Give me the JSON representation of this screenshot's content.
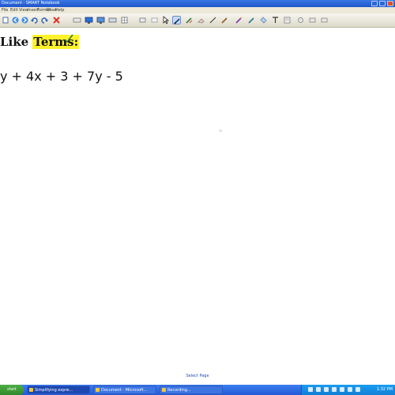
{
  "window": {
    "title": "Document - SMART Notebook"
  },
  "menu": {
    "items": [
      "File",
      "Edit",
      "View",
      "Insert",
      "Format",
      "Draw",
      "Help"
    ]
  },
  "toolbar": {
    "buttons": [
      {
        "name": "new-page-icon"
      },
      {
        "name": "previous-page-icon"
      },
      {
        "name": "next-page-icon"
      },
      {
        "name": "undo-icon"
      },
      {
        "name": "redo-icon"
      },
      {
        "name": "delete-icon"
      },
      {
        "name": "screen-shade-icon"
      },
      {
        "name": "full-screen-icon"
      },
      {
        "name": "dual-page-icon"
      },
      {
        "name": "insert-table-icon"
      },
      {
        "name": "select-icon"
      },
      {
        "name": "pen-icon"
      },
      {
        "name": "creative-pen-icon"
      },
      {
        "name": "eraser-icon"
      },
      {
        "name": "line-icon"
      },
      {
        "name": "shapes-icon"
      },
      {
        "name": "magic-pen-icon"
      },
      {
        "name": "shape-recognition-icon"
      },
      {
        "name": "fill-icon"
      },
      {
        "name": "text-icon"
      },
      {
        "name": "properties-icon"
      }
    ]
  },
  "content": {
    "heading_prefix": "Like ",
    "heading_highlight": "Terms:",
    "expression": "y + 4x + 3 + 7y - 5",
    "page_link": "Select Page"
  },
  "taskbar": {
    "start_label": "start",
    "tasks": [
      {
        "label": "Simplifying expre...",
        "active": true
      },
      {
        "label": "Document - Microsoft..."
      },
      {
        "label": "Recording..."
      }
    ],
    "clock": "1:32 PM"
  },
  "colors": {
    "highlight": "#fff22a",
    "titlebar": "#1e55c8",
    "taskbar": "#2459d6"
  }
}
